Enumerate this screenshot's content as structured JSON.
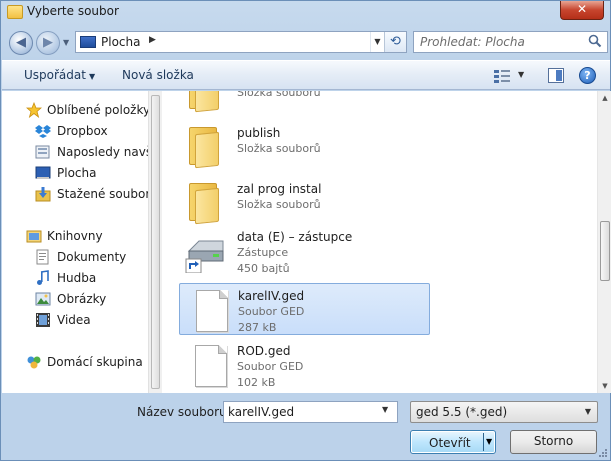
{
  "window": {
    "title": "Vyberte soubor",
    "close_glyph": "✕"
  },
  "nav": {
    "back_glyph": "◀",
    "forward_glyph": "▶",
    "address": "Plocha",
    "address_arrow": "▶",
    "search_placeholder": "Prohledat: Plocha"
  },
  "toolbar": {
    "organize": "Uspořádat",
    "new_folder": "Nová složka",
    "help": "?"
  },
  "sidebar": {
    "items": [
      {
        "label": "Oblíbené položky",
        "icon": "star-icon"
      },
      {
        "label": "Dropbox",
        "icon": "dropbox-icon"
      },
      {
        "label": "Naposledy navštívená místa",
        "icon": "recent-places-icon"
      },
      {
        "label": "Plocha",
        "icon": "desktop-icon"
      },
      {
        "label": "Stažené soubory",
        "icon": "downloads-icon"
      },
      {
        "label": "Knihovny",
        "icon": "libraries-icon"
      },
      {
        "label": "Dokumenty",
        "icon": "documents-icon"
      },
      {
        "label": "Hudba",
        "icon": "music-icon"
      },
      {
        "label": "Obrázky",
        "icon": "pictures-icon"
      },
      {
        "label": "Videa",
        "icon": "videos-icon"
      },
      {
        "label": "Domácí skupina",
        "icon": "homegroup-icon"
      }
    ]
  },
  "files": [
    {
      "name": "",
      "type": "Složka souborů",
      "size": ""
    },
    {
      "name": "publish",
      "type": "Složka souborů",
      "size": ""
    },
    {
      "name": "zal prog instal",
      "type": "Složka souborů",
      "size": ""
    },
    {
      "name": "data (E) – zástupce",
      "type": "Zástupce",
      "size": "450 bajtů"
    },
    {
      "name": "karelIV.ged",
      "type": "Soubor GED",
      "size": "287 kB"
    },
    {
      "name": "ROD.ged",
      "type": "Soubor GED",
      "size": "102 kB"
    }
  ],
  "footer": {
    "filename_label": "Název souboru:",
    "filename_value": "karelIV.ged",
    "filter_value": "ged 5.5 (*.ged)",
    "open_label": "Otevřít",
    "cancel_label": "Storno"
  },
  "colors": {
    "selection": "#cce0fa",
    "selection_border": "#84acdd",
    "folder": "#f3cf6a"
  }
}
